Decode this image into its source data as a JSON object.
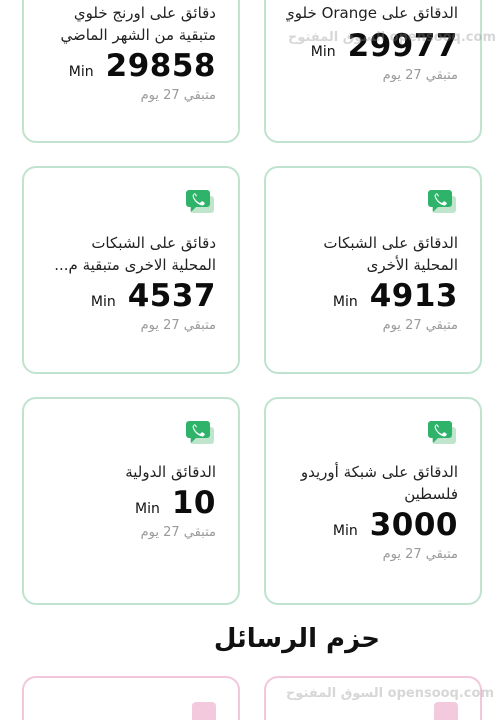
{
  "cards": [
    {
      "title_lines": [
        "دقائق على اورنج خلوي",
        "متبقية من الشهر الماضي"
      ],
      "unit": "Min",
      "value": "29858",
      "remaining": "متبقي 27 يوم"
    },
    {
      "title_lines": [
        "الدقائق على Orange خلوي"
      ],
      "unit": "Min",
      "value": "29977",
      "remaining": "متبقي 27 يوم"
    },
    {
      "title_lines": [
        "دقائق على الشبكات",
        "المحلية الاخرى متبقية م..."
      ],
      "unit": "Min",
      "value": "4537",
      "remaining": "متبقي 27 يوم",
      "icon": "green-chat-phone-icon"
    },
    {
      "title_lines": [
        "الدقائق على الشبكات",
        "المحلية الأخرى"
      ],
      "unit": "Min",
      "value": "4913",
      "remaining": "متبقي 27 يوم",
      "icon": "green-chat-phone-icon"
    },
    {
      "title_lines": [
        "الدقائق الدولية"
      ],
      "unit": "Min",
      "value": "10",
      "remaining": "متبقي 27 يوم",
      "icon": "green-chat-phone-icon"
    },
    {
      "title_lines": [
        "الدقائق على شبكة أوريدو",
        "فلسطين"
      ],
      "unit": "Min",
      "value": "3000",
      "remaining": "متبقي 27 يوم",
      "icon": "green-chat-phone-icon"
    }
  ],
  "section": {
    "title": "حزم الرسائل"
  },
  "watermark": {
    "text": "السوق المفتوح opensooq.com"
  },
  "colors": {
    "card_border": "#bfe3cf",
    "icon_green": "#2fb36a",
    "pink_border": "#f2c7dc"
  }
}
